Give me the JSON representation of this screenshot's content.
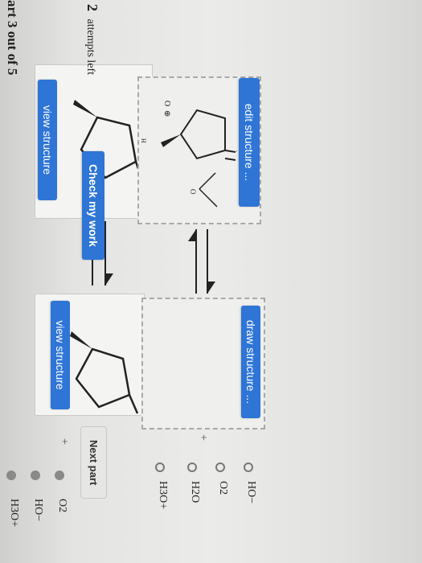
{
  "part_header": "art 3 out of 5",
  "attempts": {
    "count": "2",
    "label": "attempts left"
  },
  "buttons": {
    "check_my_work": "Check my work",
    "next_part": "Next part",
    "view_structure_1": "view structure",
    "view_structure_2": "view structure",
    "edit_structure": "edit structure ...",
    "draw_structure": "draw structure ..."
  },
  "reaction": {
    "plus_top": "+",
    "plus_bottom": "+"
  },
  "structure_labels": {
    "oxonium_o": "O",
    "oxonium_charge": "⊕",
    "h": "H",
    "water_o": "O"
  },
  "reactants_options": [
    "H3O+",
    "HO−",
    "O2"
  ],
  "options": [
    "HO−",
    "O2",
    "H2O",
    "H3O+"
  ],
  "colors": {
    "button_blue": "#2e75d6"
  }
}
